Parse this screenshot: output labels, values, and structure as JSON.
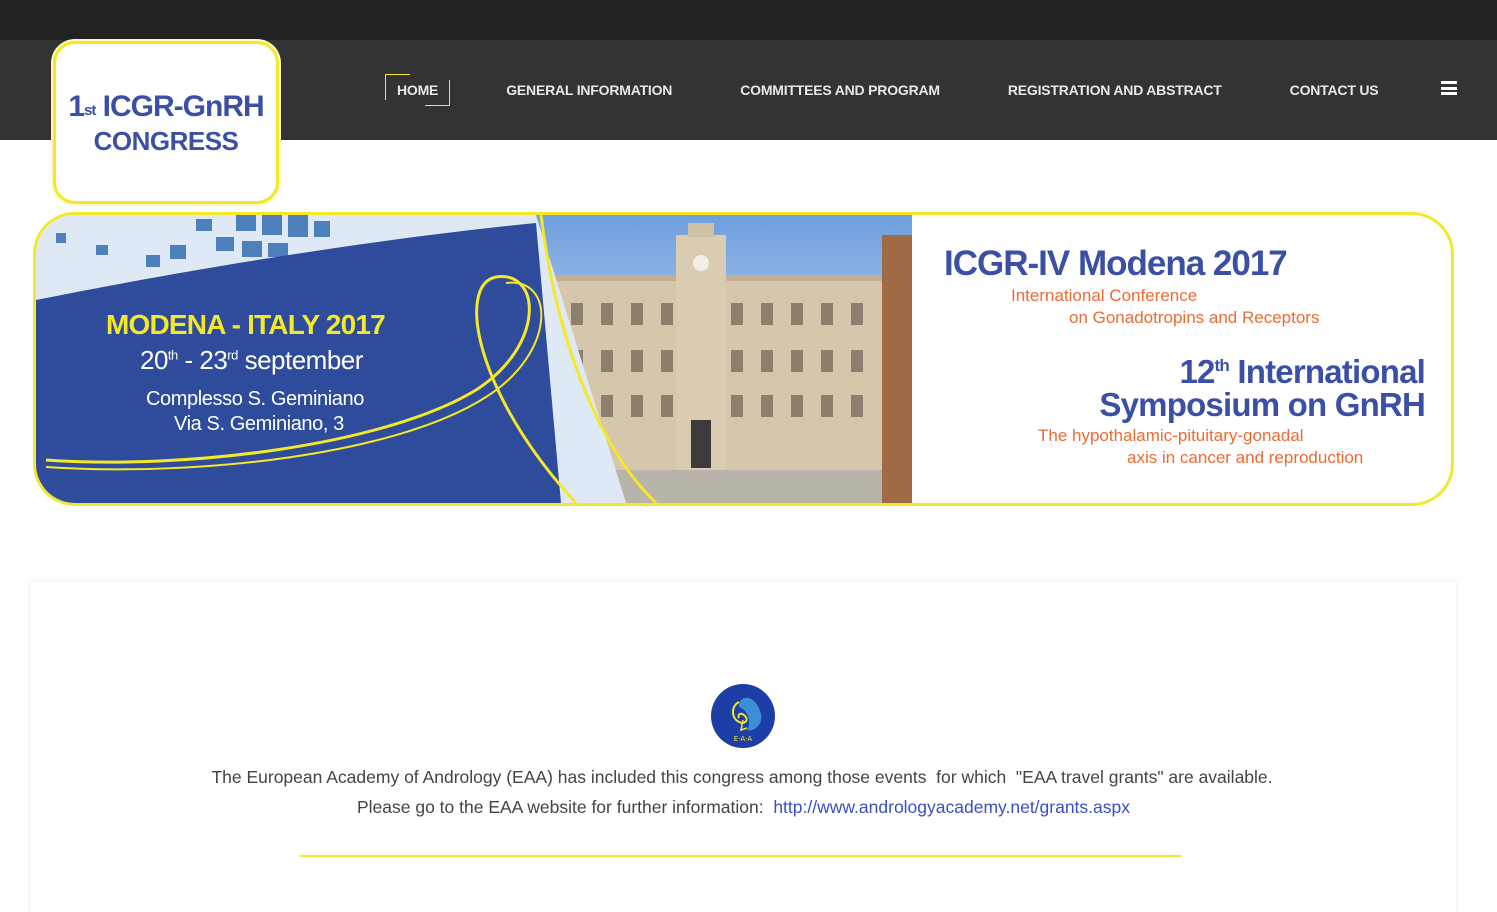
{
  "logo": {
    "line1_prefix": "1",
    "line1_sup": "st",
    "line1_main": " ICGR-GnRH",
    "line2": "CONGRESS"
  },
  "nav": {
    "items": [
      {
        "label": "HOME",
        "active": true
      },
      {
        "label": "GENERAL INFORMATION"
      },
      {
        "label": "COMMITTEES AND PROGRAM"
      },
      {
        "label": "REGISTRATION AND ABSTRACT"
      },
      {
        "label": "CONTACT US"
      }
    ],
    "menu_icon": "hamburger-menu-icon"
  },
  "banner": {
    "location": "MODENA - ITALY 2017",
    "date_start": "20",
    "date_start_sup": "th",
    "date_sep": " - 23",
    "date_end_sup": "rd",
    "date_month": " september",
    "venue_line1": "Complesso S. Geminiano",
    "venue_line2": "Via S. Geminiano, 3",
    "conference_title": "ICGR-IV Modena 2017",
    "conference_sub1": "International Conference",
    "conference_sub2": "on Gonadotropins and Receptors",
    "symposium_num": "12",
    "symposium_sup": "th",
    "symposium_line1": " International",
    "symposium_line2": "Symposium on GnRH",
    "symposium_sub1": "The hypothalamic-pituitary-gonadal",
    "symposium_sub2": "axis in cancer and reproduction"
  },
  "content": {
    "eaa_logo_text": "E·A·A",
    "line1": "The European Academy of Andrology (EAA) has included this congress among those events  for which  \"EAA travel grants\" are available.",
    "line2_prefix": "Please go to the EAA website for further information:  ",
    "link": "http://www.andrologyacademy.net/grants.aspx"
  },
  "colors": {
    "accent_yellow": "#f3e829",
    "brand_blue": "#3b4fa6",
    "banner_blue": "#2f4b9b",
    "accent_orange": "#ee6a33",
    "link_blue": "#3a4ec7",
    "nav_bg": "#333333",
    "top_bar_bg": "#222222"
  }
}
